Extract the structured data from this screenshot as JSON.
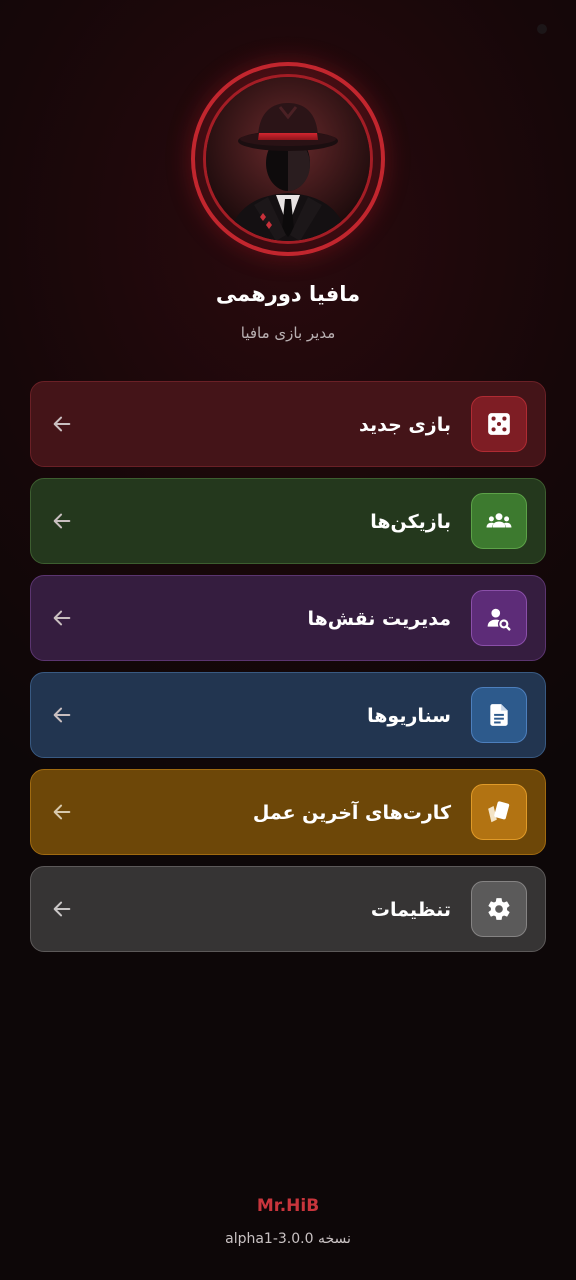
{
  "app": {
    "title": "مافیا دورهمی",
    "subtitle": "مدیر بازی مافیا"
  },
  "avatar": {
    "icon": "mafia-hat-man-icon"
  },
  "menu": [
    {
      "label": "بازی جدید",
      "icon": "dice-icon",
      "accent": "#7e1d24"
    },
    {
      "label": "بازیکن‌ها",
      "icon": "group-icon",
      "accent": "#3d7a2f"
    },
    {
      "label": "مدیریت نقش‌ها",
      "icon": "person-search-icon",
      "accent": "#5d2c78"
    },
    {
      "label": "سناریوها",
      "icon": "document-icon",
      "accent": "#2d5a8c"
    },
    {
      "label": "کارت‌های آخرین عمل",
      "icon": "cards-icon",
      "accent": "#b27312"
    },
    {
      "label": "تنظیمات",
      "icon": "gear-icon",
      "accent": "#5b5a5a"
    }
  ],
  "footer": {
    "author": "Mr.HiB",
    "version": "نسخه alpha1-3.0.0"
  }
}
